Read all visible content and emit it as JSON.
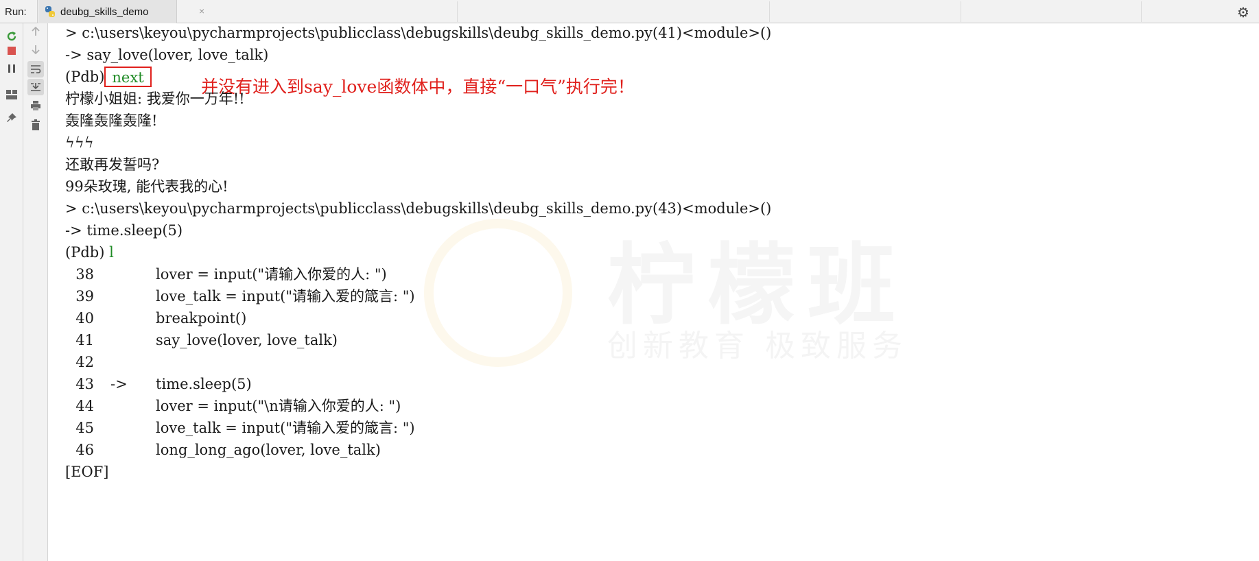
{
  "run_panel": {
    "label": "Run:",
    "tab": {
      "title": "deubg_skills_demo",
      "close": "×"
    }
  },
  "icons": {
    "rerun": "rerun-icon",
    "stop": "stop-icon",
    "pause": "pause-icon",
    "layout": "layout-icon",
    "pin": "pin-icon",
    "up": "arrow-up-icon",
    "down": "arrow-down-icon",
    "soft_wrap": "soft-wrap-icon",
    "scroll_end": "scroll-to-end-icon",
    "print": "print-icon",
    "trash": "trash-icon",
    "settings": "gear-icon"
  },
  "colors": {
    "accent_red": "#e0201c",
    "command_green": "#1e8a24",
    "rerun_green": "#3a9a3a",
    "stop_red": "#d9534f"
  },
  "console": {
    "line1": "> c:\\users\\keyou\\pycharmprojects\\publicclass\\debugskills\\deubg_skills_demo.py(41)<module>()",
    "line2": "-> say_love(lover, love_talk)",
    "line3_prompt": "(Pdb)",
    "line3_cmd": "next",
    "annotation": "并没有进入到say_love函数体中，直接“一口气”执行完！",
    "line4": "柠檬小姐姐: 我爱你一万年!!",
    "line5": "轰隆轰隆轰隆!",
    "line6": "ϟϟϟ",
    "line7": "还敢再发誓吗?",
    "line8": "99朵玫瑰, 能代表我的心!",
    "line9": "> c:\\users\\keyou\\pycharmprojects\\publicclass\\debugskills\\deubg_skills_demo.py(43)<module>()",
    "line10": "-> time.sleep(5)",
    "line11_prompt": "(Pdb) ",
    "line11_cmd": "l",
    "listing": [
      {
        "num": "38",
        "marker": "",
        "code": "lover = input(\"请输入你爱的人: \")"
      },
      {
        "num": "39",
        "marker": "",
        "code": "love_talk = input(\"请输入爱的箴言: \")"
      },
      {
        "num": "40",
        "marker": "",
        "code": "breakpoint()"
      },
      {
        "num": "41",
        "marker": "",
        "code": "say_love(lover, love_talk)"
      },
      {
        "num": "42",
        "marker": "",
        "code": ""
      },
      {
        "num": "43",
        "marker": "->",
        "code": "time.sleep(5)"
      },
      {
        "num": "44",
        "marker": "",
        "code": "lover = input(\"\\n请输入你爱的人: \")"
      },
      {
        "num": "45",
        "marker": "",
        "code": "love_talk = input(\"请输入爱的箴言: \")"
      },
      {
        "num": "46",
        "marker": "",
        "code": "long_long_ago(lover, love_talk)"
      }
    ],
    "eof": "[EOF]"
  },
  "watermark": {
    "title": "柠檬班",
    "subtitle": "创新教育  极致服务"
  }
}
